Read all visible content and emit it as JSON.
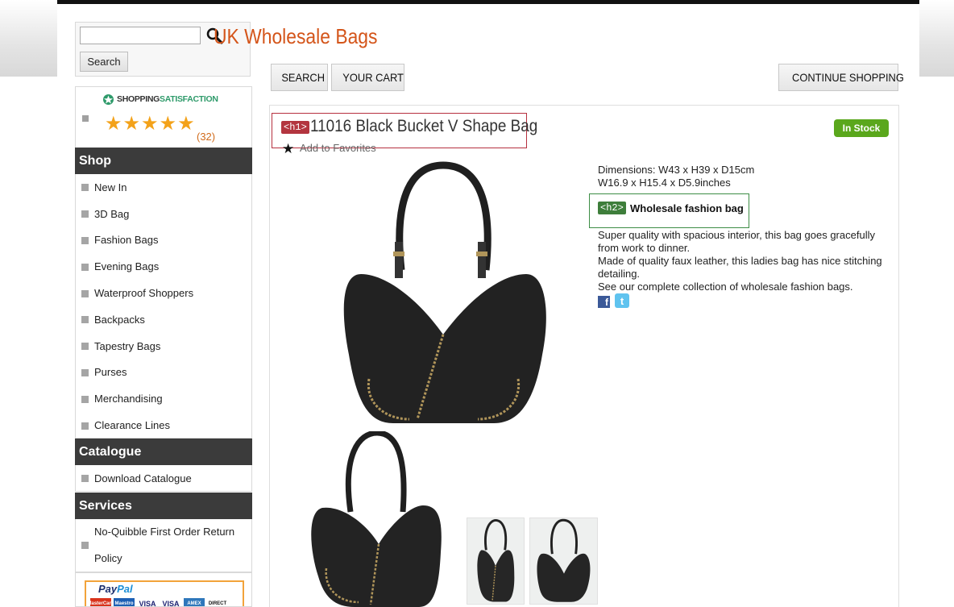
{
  "site": {
    "title": "UK Wholesale Bags"
  },
  "sidebar": {
    "search": {
      "placeholder": "",
      "button_label": "Search"
    },
    "rating": {
      "logo_part1": "SHOPPING",
      "logo_part2": "SATISFACTION",
      "stars": 5,
      "count_text": "(32)"
    },
    "categories": [
      {
        "title": "Shop",
        "items": [
          "New In",
          "3D Bag",
          "Fashion Bags",
          "Evening Bags",
          "Waterproof Shoppers",
          "Backpacks",
          "Tapestry Bags",
          "Purses",
          "Merchandising",
          "Clearance Lines"
        ]
      },
      {
        "title": "Catalogue",
        "items": [
          "Download Catalogue"
        ]
      },
      {
        "title": "Services",
        "items": [
          "No-Quibble First Order Return Policy"
        ]
      }
    ],
    "payment": {
      "logo_part1": "Pay",
      "logo_part2": "Pal",
      "cards": [
        "MasterCard",
        "Maestro",
        "VISA",
        "VISA",
        "AMEX",
        "DIRECT"
      ]
    }
  },
  "nav": {
    "search_label": "SEARCH",
    "cart_label": "YOUR CART",
    "continue_label": "CONTINUE SHOPPING"
  },
  "product": {
    "h1_tag": "<h1>",
    "title": "11016 Black Bucket V Shape Bag",
    "favorites_label": "Add to Favorites",
    "stock_status": "In Stock",
    "dimensions_line1": "Dimensions: W43 x H39 x D15cm",
    "dimensions_line2": "W16.9 x H15.4 x D5.9inches",
    "h2_tag": "<h2>",
    "subtitle": "Wholesale fashion bag",
    "description": [
      "Super quality with spacious interior, this bag goes gracefully from work to dinner.",
      "Made of quality faux leather, this ladies bag has nice stitching detailing.",
      "See our complete collection of wholesale fashion bags."
    ],
    "social": [
      "facebook",
      "twitter"
    ]
  },
  "colors": {
    "title_orange": "#d4551a",
    "header_dark": "#3b3b3b",
    "stock_green": "#5aa71c",
    "h1_red": "#b3353f",
    "h2_green": "#3e7e3b",
    "star_gold": "#f3a21a"
  }
}
